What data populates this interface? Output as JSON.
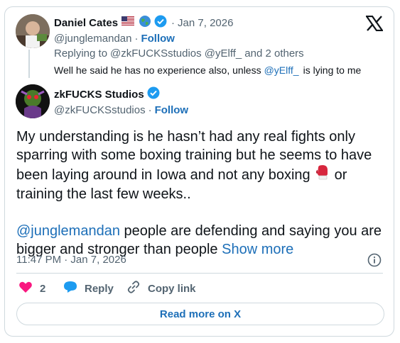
{
  "parent": {
    "display_name": "Daniel Cates",
    "handle": "@junglemandan",
    "date_sep": "·",
    "date": "Jan 7, 2026",
    "follow_label": "Follow",
    "handle_sep": "·",
    "replying_prefix": "Replying to",
    "replying_users": "@zkFUCKSstudios @yElff_",
    "replying_suffix": "and 2 others",
    "text_before": "Well he said he has no experience also, unless",
    "text_mention": "@yElff_",
    "text_after": "is lying to me"
  },
  "tweet": {
    "display_name": "zkFUCKS Studios",
    "handle": "@zkFUCKSstudios",
    "handle_sep": "·",
    "follow_label": "Follow",
    "body_line1": "My understanding is he hasn’t had any real fights only",
    "body_line2": "sparring with some boxing training but he seems to have",
    "body_line3a": "been laying around in Iowa and not any boxing",
    "body_line3b": "or",
    "body_line4": "training the last few weeks..",
    "mention": "@junglemandan",
    "body_line5": "people are defending and saying you are",
    "body_line6": "bigger and stronger than people",
    "show_more": "Show more",
    "timestamp": "11:47 PM · Jan 7, 2026"
  },
  "actions": {
    "like_count": "2",
    "reply_label": "Reply",
    "copy_link_label": "Copy link"
  },
  "read_more_label": "Read more on X",
  "colors": {
    "accent": "#1d9bf0",
    "link": "#1d6fb8",
    "like": "#f91880",
    "muted": "#536471",
    "border": "#cfd9de"
  },
  "icons": [
    "x-logo-icon",
    "us-flag-icon",
    "globe-icon",
    "verified-badge-icon",
    "info-icon",
    "heart-icon",
    "reply-bubble-icon",
    "link-icon",
    "boxing-glove-icon"
  ]
}
